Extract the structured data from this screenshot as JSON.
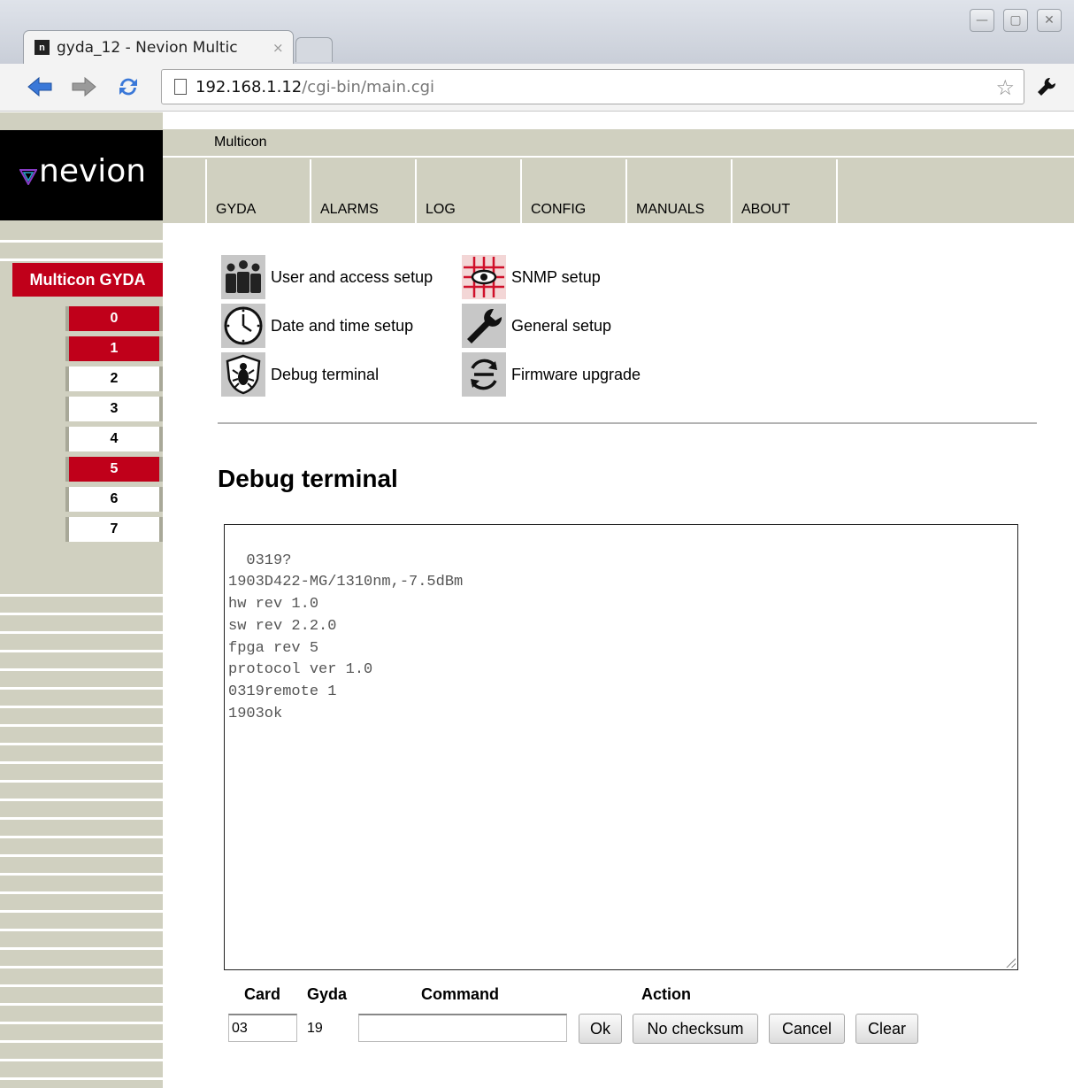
{
  "browser": {
    "tab_title": "gyda_12 - Nevion Multic",
    "tab_close": "×",
    "url_host": "192.168.1.12",
    "url_path": "/cgi-bin/main.cgi",
    "favicon": "n",
    "icons": [
      "back-arrow-icon",
      "forward-arrow-icon",
      "reload-icon",
      "page-icon",
      "star-icon",
      "wrench-icon",
      "minimize-icon",
      "maximize-icon",
      "close-icon"
    ]
  },
  "sidebar": {
    "logo_text": "nevion",
    "system_title": "Multicon GYDA",
    "cards": [
      {
        "label": "0",
        "status": "alarm"
      },
      {
        "label": "1",
        "status": "alarm"
      },
      {
        "label": "2",
        "status": "ok"
      },
      {
        "label": "3",
        "status": "ok"
      },
      {
        "label": "4",
        "status": "ok"
      },
      {
        "label": "5",
        "status": "alarm"
      },
      {
        "label": "6",
        "status": "ok"
      },
      {
        "label": "7",
        "status": "ok"
      }
    ]
  },
  "header": {
    "breadcrumb": "Multicon",
    "menu": [
      "GYDA",
      "ALARMS",
      "LOG",
      "CONFIG",
      "MANUALS",
      "ABOUT"
    ]
  },
  "setup_links": {
    "user_access": "User and access setup",
    "snmp": "SNMP setup",
    "date_time": "Date and time setup",
    "general": "General setup",
    "debug": "Debug terminal",
    "firmware": "Firmware upgrade"
  },
  "main": {
    "heading": "Debug terminal",
    "terminal_lines": "0319?\n1903D422-MG/1310nm,-7.5dBm\nhw rev 1.0\nsw rev 2.2.0\nfpga rev 5\nprotocol ver 1.0\n0319remote 1\n1903ok"
  },
  "form": {
    "headers": {
      "card": "Card",
      "gyda": "Gyda",
      "command": "Command",
      "action": "Action"
    },
    "card_value": "03",
    "gyda_value": "19",
    "command_value": "",
    "buttons": {
      "ok": "Ok",
      "no_checksum": "No checksum",
      "cancel": "Cancel",
      "clear": "Clear"
    }
  },
  "colors": {
    "alarm_red": "#c0001a",
    "panel_beige": "#d0d0c0",
    "logo_black": "#000000"
  }
}
